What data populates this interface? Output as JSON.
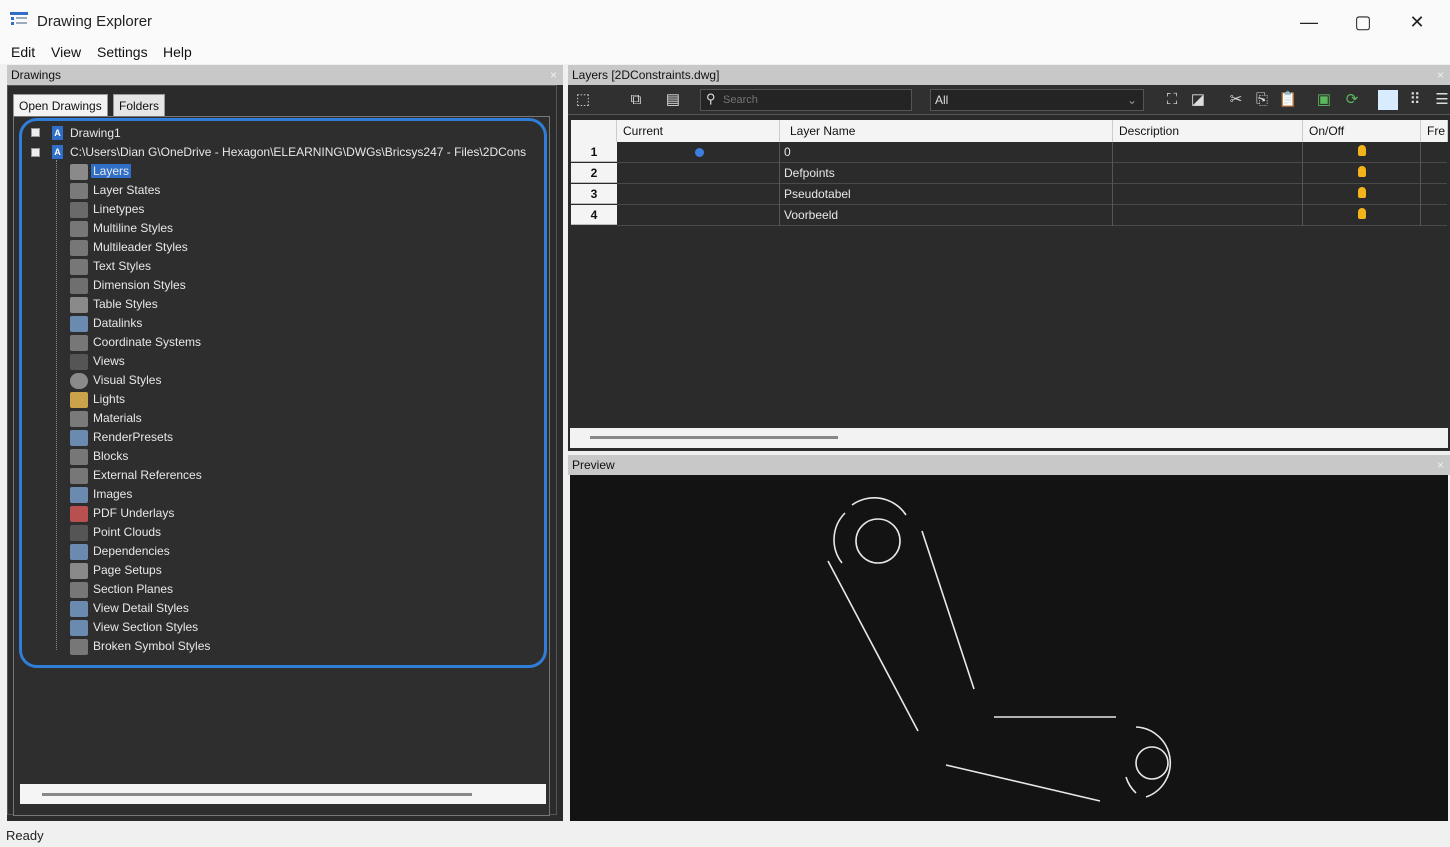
{
  "window": {
    "title": "Drawing Explorer",
    "minimize": "—",
    "maximize": "▢",
    "close": "✕"
  },
  "menu": [
    "Edit",
    "View",
    "Settings",
    "Help"
  ],
  "drawings_panel": {
    "title": "Drawings",
    "close": "×",
    "tabs": [
      "Open Drawings",
      "Folders"
    ],
    "tree": {
      "root1": "Drawing1",
      "root2": "C:\\Users\\Dian G\\OneDrive - Hexagon\\ELEARNING\\DWGs\\Bricsys247 - Files\\2DCons",
      "items": [
        "Layers",
        "Layer States",
        "Linetypes",
        "Multiline Styles",
        "Multileader Styles",
        "Text Styles",
        "Dimension Styles",
        "Table Styles",
        "Datalinks",
        "Coordinate Systems",
        "Views",
        "Visual Styles",
        "Lights",
        "Materials",
        "RenderPresets",
        "Blocks",
        "External References",
        "Images",
        "PDF Underlays",
        "Point Clouds",
        "Dependencies",
        "Page Setups",
        "Section Planes",
        "View Detail Styles",
        "View Section Styles",
        "Broken Symbol Styles"
      ],
      "selected": "Layers"
    }
  },
  "layers_panel": {
    "title": "Layers [2DConstraints.dwg]",
    "close": "×",
    "search_placeholder": "Search",
    "filter_value": "All",
    "columns": [
      "Current",
      "Layer Name",
      "Description",
      "On/Off",
      "Fre"
    ],
    "rows": [
      {
        "num": "1",
        "name": "0",
        "current": true
      },
      {
        "num": "2",
        "name": "Defpoints",
        "current": false
      },
      {
        "num": "3",
        "name": "Pseudotabel",
        "current": false
      },
      {
        "num": "4",
        "name": "Voorbeeld",
        "current": false
      }
    ]
  },
  "preview_panel": {
    "title": "Preview",
    "close": "×"
  },
  "status": "Ready",
  "colors": {
    "accent_ring": "#2f7ed8",
    "panel_bg": "#2b2b2b",
    "bulb": "#f3b31b"
  }
}
